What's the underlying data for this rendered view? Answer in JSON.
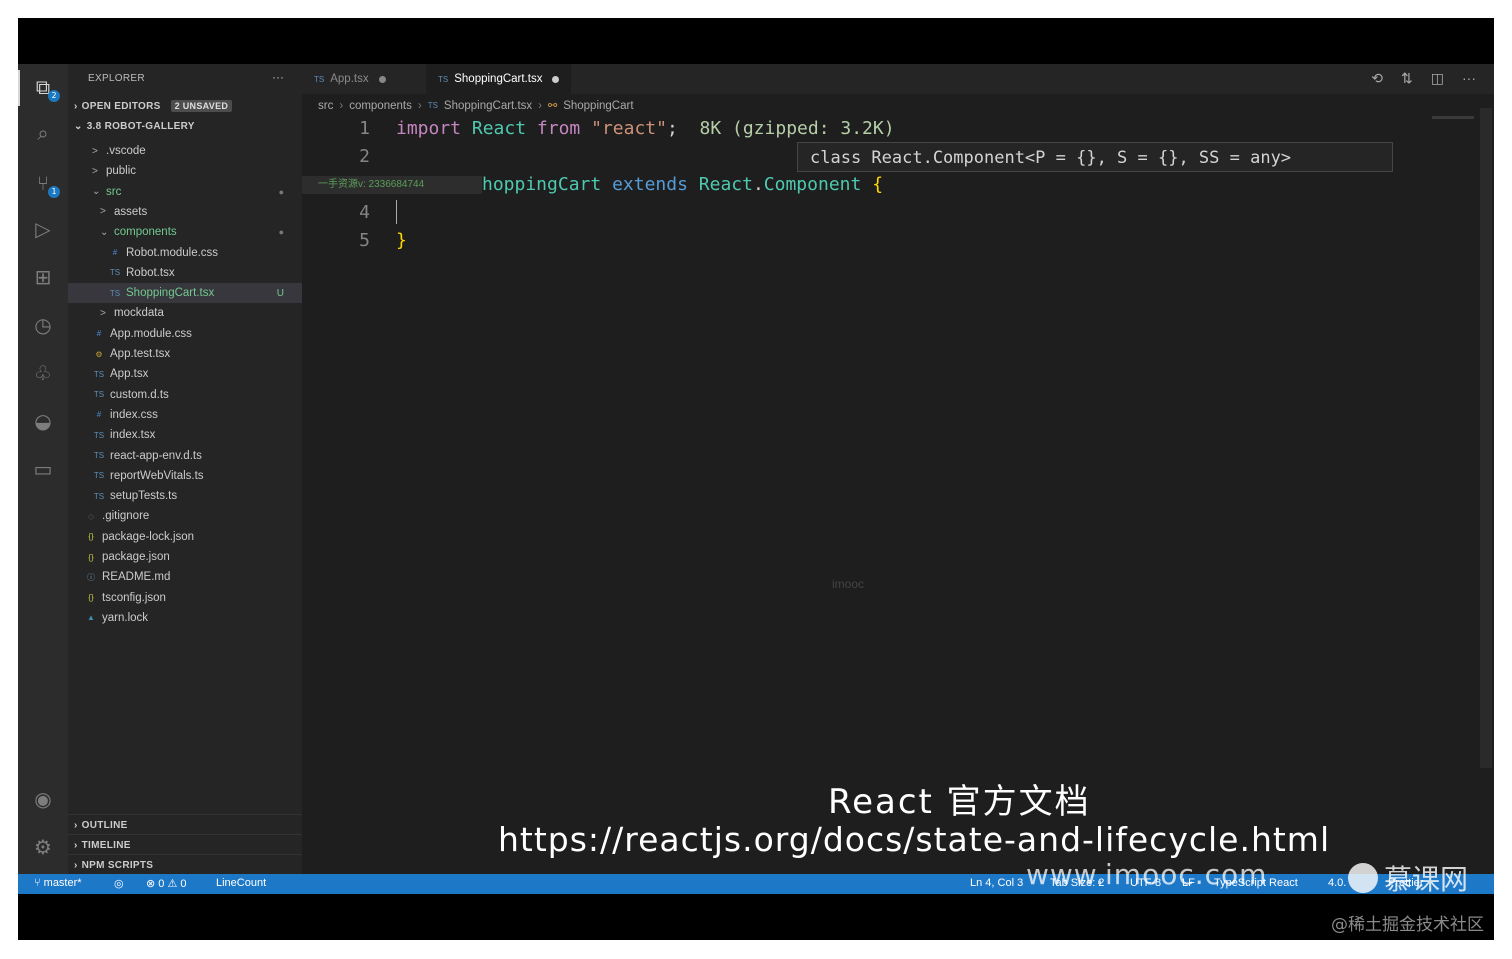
{
  "sidebar": {
    "title": "EXPLORER",
    "more": "···",
    "open_editors": "OPEN EDITORS",
    "unsaved_badge": "2 UNSAVED",
    "project": "3.8 ROBOT-GALLERY",
    "tree": [
      {
        "name": ".vscode",
        "kind": "folder",
        "icon": ">"
      },
      {
        "name": "public",
        "kind": "folder",
        "icon": ">"
      },
      {
        "name": "src",
        "kind": "folder-open",
        "icon": "⌄"
      },
      {
        "name": "assets",
        "kind": "folder",
        "icon": ">"
      },
      {
        "name": "components",
        "kind": "folder-open",
        "icon": "⌄"
      },
      {
        "name": "Robot.module.css",
        "kind": "css",
        "icon": "#"
      },
      {
        "name": "Robot.tsx",
        "kind": "ts",
        "icon": "TS"
      },
      {
        "name": "ShoppingCart.tsx",
        "kind": "ts",
        "icon": "TS",
        "status": "U"
      },
      {
        "name": "mockdata",
        "kind": "folder",
        "icon": ">"
      },
      {
        "name": "App.module.css",
        "kind": "css",
        "icon": "#"
      },
      {
        "name": "App.test.tsx",
        "kind": "test",
        "icon": "⚙"
      },
      {
        "name": "App.tsx",
        "kind": "ts",
        "icon": "TS"
      },
      {
        "name": "custom.d.ts",
        "kind": "ts",
        "icon": "TS"
      },
      {
        "name": "index.css",
        "kind": "css",
        "icon": "#"
      },
      {
        "name": "index.tsx",
        "kind": "ts",
        "icon": "TS"
      },
      {
        "name": "react-app-env.d.ts",
        "kind": "ts",
        "icon": "TS"
      },
      {
        "name": "reportWebVitals.ts",
        "kind": "ts",
        "icon": "TS"
      },
      {
        "name": "setupTests.ts",
        "kind": "ts",
        "icon": "TS"
      },
      {
        "name": ".gitignore",
        "kind": "git",
        "icon": "◇"
      },
      {
        "name": "package-lock.json",
        "kind": "json",
        "icon": "{}"
      },
      {
        "name": "package.json",
        "kind": "json",
        "icon": "{}"
      },
      {
        "name": "README.md",
        "kind": "info",
        "icon": "ⓘ"
      },
      {
        "name": "tsconfig.json",
        "kind": "json",
        "icon": "{}"
      },
      {
        "name": "yarn.lock",
        "kind": "yarn",
        "icon": "▲"
      }
    ],
    "outline": "OUTLINE",
    "timeline": "TIMELINE",
    "npm_scripts": "NPM SCRIPTS"
  },
  "tabs": [
    {
      "label": "App.tsx",
      "icon": "TS",
      "active": false
    },
    {
      "label": "ShoppingCart.tsx",
      "icon": "TS",
      "active": true
    }
  ],
  "breadcrumb": {
    "src": "src",
    "components": "components",
    "file": "ShoppingCart.tsx",
    "symbol": "ShoppingCart"
  },
  "code": {
    "line_numbers": [
      "1",
      "2",
      "4",
      "5"
    ],
    "line1_import": "import",
    "line1_react": "React",
    "line1_from": "from",
    "line1_module": "\"react\"",
    "line1_semicolon": ";",
    "line1_size": "8K (gzipped: 3.2K)",
    "line3_visible": "hoppingCart",
    "line3_extends": "extends",
    "line3_react": "React",
    "line3_component": "Component",
    "line3_brace": "{",
    "line5_brace": "}",
    "hover": "class React.Component<P = {}, S = {}, SS = any>",
    "gutter_note": "一手资源v: 2336684744",
    "faint_watermark": "imooc"
  },
  "statusbar": {
    "branch": "master*",
    "errors": "⊗ 0",
    "warnings": "⚠ 0",
    "linecount": "LineCount",
    "position": "Ln 4, Col 3",
    "tab_size": "Tab Size: 2",
    "encoding": "UTF-8",
    "eol": "LF",
    "language": "TypeScript React",
    "version": "4.0.",
    "prettier": "Prettier"
  },
  "overlay": {
    "caption_title": "React 官方文档",
    "caption_url": "https://reactjs.org/docs/state-and-lifecycle.html",
    "site": "www.imooc.com",
    "logo_text": "慕课网",
    "credit": "@稀土掘金技术社区"
  }
}
